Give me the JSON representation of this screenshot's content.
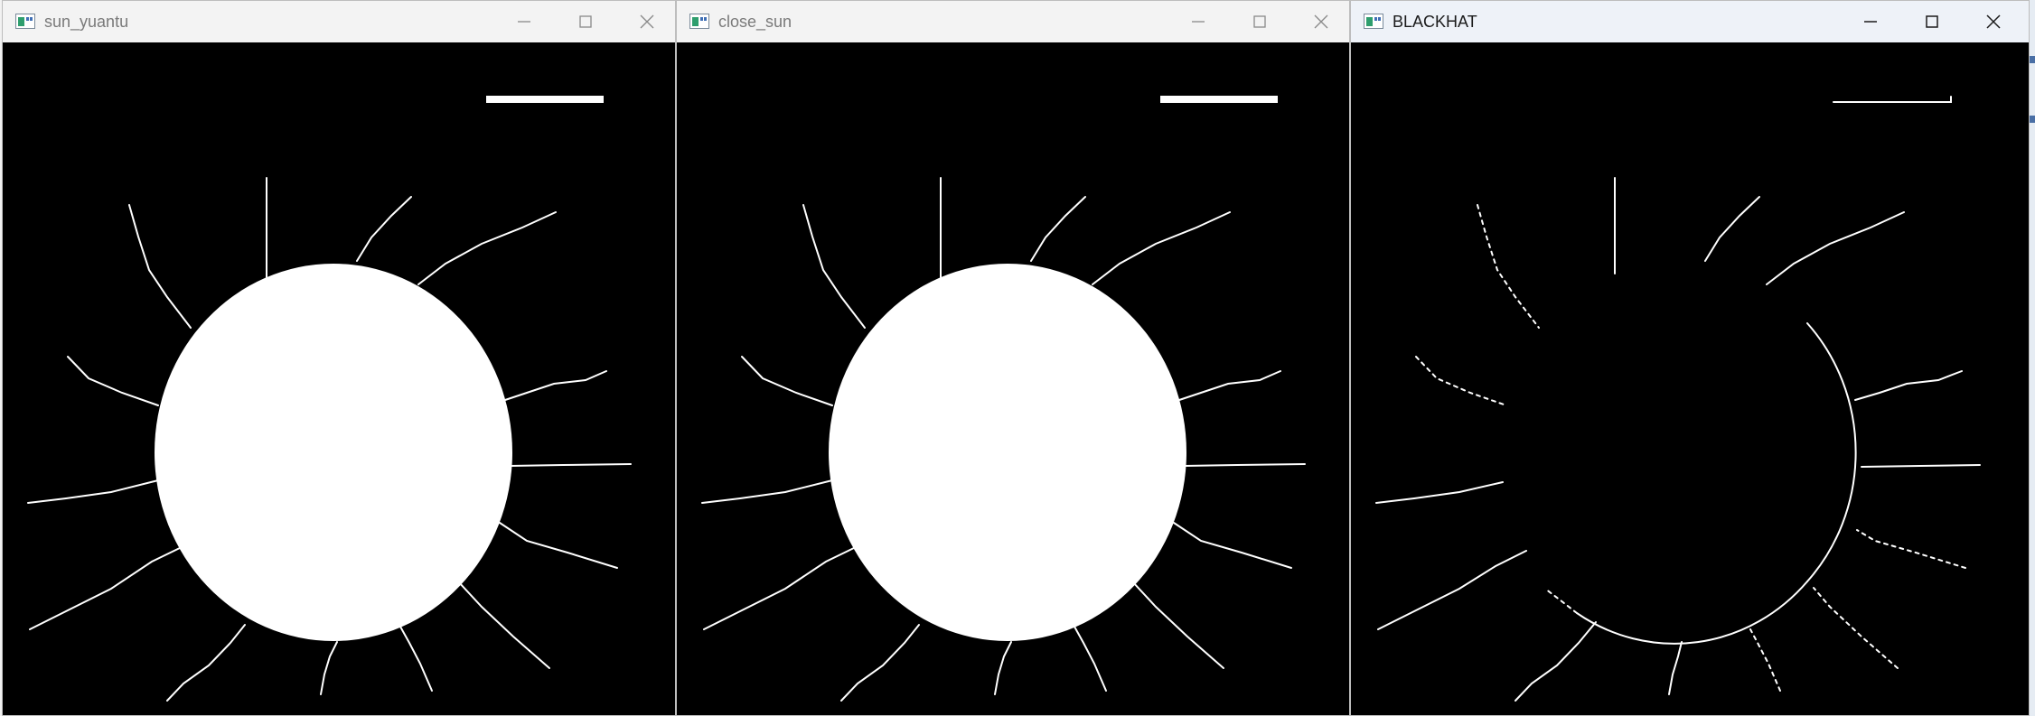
{
  "windows": [
    {
      "title": "sun_yuantu",
      "variant": "original",
      "active": false
    },
    {
      "title": "close_sun",
      "variant": "closed",
      "active": false
    },
    {
      "title": "BLACKHAT",
      "variant": "blackhat",
      "active": true
    }
  ],
  "icons": {
    "app": "opencv-window-icon",
    "minimize": "minimize-icon",
    "maximize": "maximize-icon",
    "close": "close-icon"
  },
  "colors": {
    "canvas": "#000000",
    "foreground": "#ffffff",
    "titlebar": "#f3f3f3",
    "active_titlebar": "#eef2f8",
    "inactive_title": "#7a7a7a",
    "active_title": "#1b1b1b"
  }
}
